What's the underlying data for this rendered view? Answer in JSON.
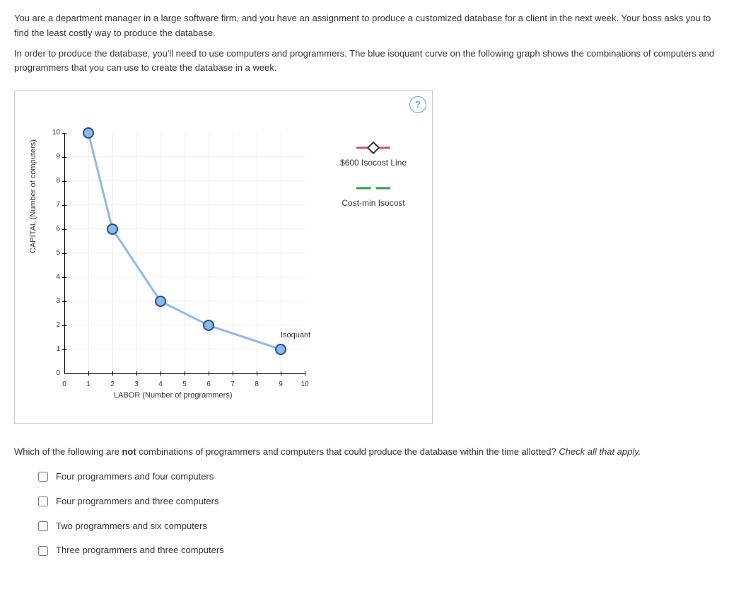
{
  "intro": {
    "p1": "You are a department manager in a large software firm, and you have an assignment to produce a customized database for a client in the next week. Your boss asks you to find the least costly way to produce the database.",
    "p2": "In order to produce the database, you'll need to use computers and programmers. The blue isoquant curve on the following graph shows the combinations of computers and programmers that you can use to create the database in a week."
  },
  "chart_data": {
    "type": "line",
    "title": "",
    "xlabel": "LABOR (Number of programmers)",
    "ylabel": "CAPITAL (Number of computers)",
    "xlim": [
      0,
      10
    ],
    "ylim": [
      0,
      10
    ],
    "x_ticks": [
      0,
      1,
      2,
      3,
      4,
      5,
      6,
      7,
      8,
      9,
      10
    ],
    "y_ticks": [
      0,
      1,
      2,
      3,
      4,
      5,
      6,
      7,
      8,
      9,
      10
    ],
    "series": [
      {
        "name": "Isoquant",
        "x": [
          1,
          2,
          4,
          6,
          9
        ],
        "y": [
          10,
          6,
          3,
          2,
          1
        ]
      }
    ],
    "legend": {
      "isocost_line": "$600 Isocost Line",
      "cost_min": "Cost-min Isocost"
    },
    "isoquant_label": "Isoquant"
  },
  "question": {
    "prompt_html_pre": "Which of the following are ",
    "prompt_bold": "not",
    "prompt_html_post": " combinations of programmers and computers that could produce the database within the time allotted? ",
    "prompt_em": "Check all that apply.",
    "options": [
      "Four programmers and four computers",
      "Four programmers and three computers",
      "Two programmers and six computers",
      "Three programmers and three computers"
    ]
  },
  "help_glyph": "?"
}
